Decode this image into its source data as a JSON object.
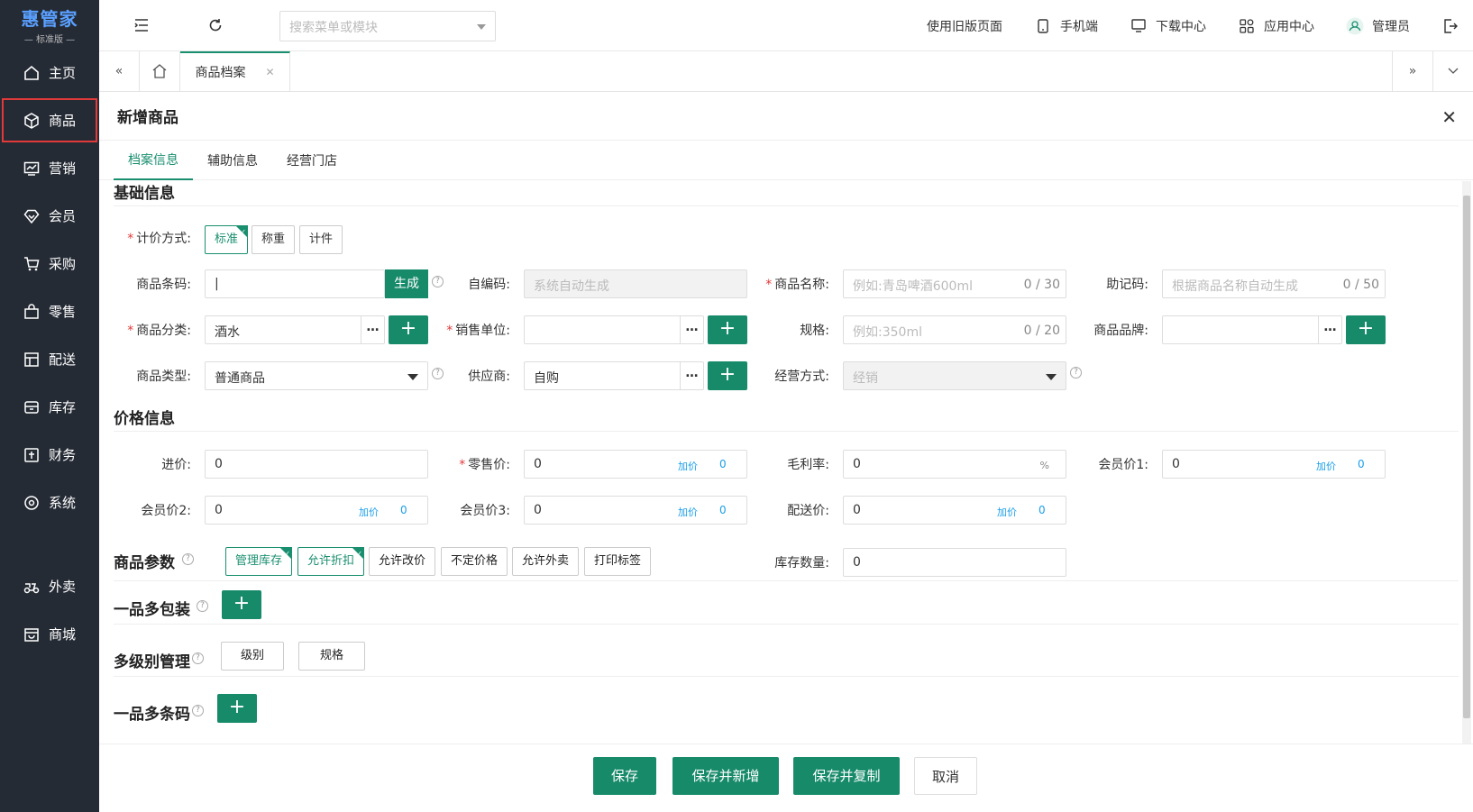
{
  "sidebar": {
    "logo_name": "惠管家",
    "logo_edition": "标准版",
    "items": [
      {
        "label": "主页",
        "icon": "home-icon"
      },
      {
        "label": "商品",
        "icon": "box-icon"
      },
      {
        "label": "营销",
        "icon": "chart-icon"
      },
      {
        "label": "会员",
        "icon": "diamond-icon"
      },
      {
        "label": "采购",
        "icon": "cart-icon"
      },
      {
        "label": "零售",
        "icon": "shop-bag-icon"
      },
      {
        "label": "配送",
        "icon": "delivery-icon"
      },
      {
        "label": "库存",
        "icon": "inventory-icon"
      },
      {
        "label": "财务",
        "icon": "finance-icon"
      },
      {
        "label": "系统",
        "icon": "settings-icon"
      },
      {
        "label": "外卖",
        "icon": "takeout-icon"
      },
      {
        "label": "商城",
        "icon": "mall-icon"
      }
    ]
  },
  "topbar": {
    "search_placeholder": "搜索菜单或模块",
    "old_page": "使用旧版页面",
    "mobile": "手机端",
    "download": "下载中心",
    "apps": "应用中心",
    "user": "管理员"
  },
  "tabs": {
    "active_tab": "商品档案"
  },
  "panel": {
    "title": "新增商品",
    "subtabs": [
      "档案信息",
      "辅助信息",
      "经营门店"
    ]
  },
  "basic": {
    "title": "基础信息",
    "pricing_method_label": "计价方式:",
    "pricing_methods": [
      "标准",
      "称重",
      "计件"
    ],
    "barcode_label": "商品条码:",
    "barcode_value": "|",
    "generate": "生成",
    "selfcode_label": "自编码:",
    "selfcode_placeholder": "系统自动生成",
    "name_label": "商品名称:",
    "name_placeholder": "例如:青岛啤酒600ml",
    "name_count": "0 / 30",
    "mnemonic_label": "助记码:",
    "mnemonic_placeholder": "根据商品名称自动生成",
    "mnemonic_count": "0 / 50",
    "category_label": "商品分类:",
    "category_value": "酒水",
    "unit_label": "销售单位:",
    "spec_label": "规格:",
    "spec_placeholder": "例如:350ml",
    "spec_count": "0 / 20",
    "brand_label": "商品品牌:",
    "type_label": "商品类型:",
    "type_value": "普通商品",
    "supplier_label": "供应商:",
    "supplier_value": "自购",
    "biz_label": "经营方式:",
    "biz_value": "经销"
  },
  "price": {
    "title": "价格信息",
    "cost_label": "进价:",
    "cost_value": "0",
    "retail_label": "零售价:",
    "retail_value": "0",
    "margin_label": "毛利率:",
    "margin_value": "0",
    "margin_unit": "%",
    "member1_label": "会员价1:",
    "member1_value": "0",
    "member2_label": "会员价2:",
    "member2_value": "0",
    "member3_label": "会员价3:",
    "member3_value": "0",
    "delivery_label": "配送价:",
    "delivery_value": "0",
    "addon_label": "加价",
    "addon_value": "0"
  },
  "params": {
    "title": "商品参数",
    "options": [
      "管理库存",
      "允许折扣",
      "允许改价",
      "不定价格",
      "允许外卖",
      "打印标签"
    ],
    "stock_label": "库存数量:",
    "stock_value": "0"
  },
  "multi_pack": {
    "title": "一品多包装"
  },
  "multi_level": {
    "title": "多级别管理",
    "level": "级别",
    "spec": "规格"
  },
  "multi_barcode": {
    "title": "一品多条码"
  },
  "footer": {
    "save": "保存",
    "save_new": "保存并新增",
    "save_copy": "保存并复制",
    "cancel": "取消"
  },
  "colors": {
    "primary": "#178a6a",
    "sidebar": "#252b35",
    "required": "#e23a3a",
    "link": "#1a9ee8"
  }
}
